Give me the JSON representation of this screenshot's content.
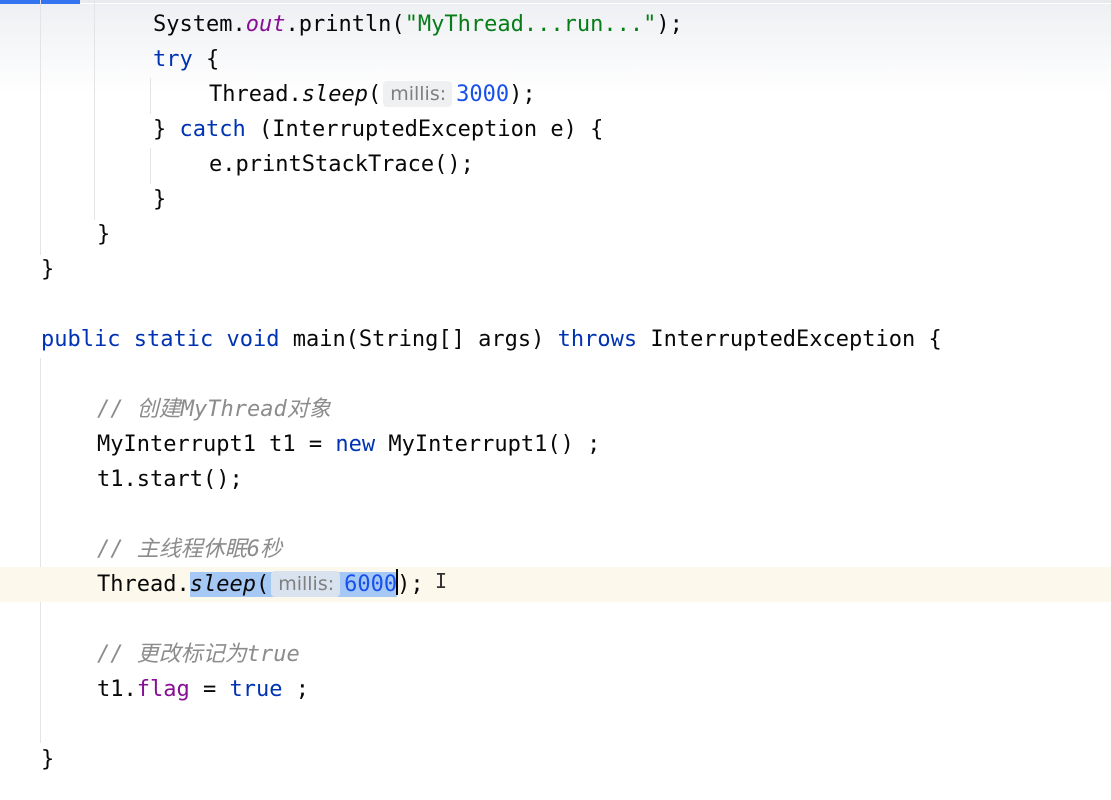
{
  "editor": {
    "language": "java",
    "current_line": "sleep_call",
    "lines": {
      "println": {
        "receiver": "System.",
        "field": "out",
        "method": ".println(",
        "string": "\"MyThread...run...\"",
        "tail": ");"
      },
      "try": {
        "keyword": "try",
        "tail": " {"
      },
      "inner_sleep": {
        "receiver": "Thread.",
        "method": "sleep",
        "paren": "(",
        "hint": "millis:",
        "arg": "3000",
        "tail": ");"
      },
      "catch": {
        "brace": "} ",
        "keyword": "catch",
        "tail": " (InterruptedException e) {"
      },
      "print_trace": {
        "text": "e.printStackTrace();"
      },
      "close_try": {
        "text": "}"
      },
      "close_run": {
        "text": "}"
      },
      "close_class": {
        "text": "}"
      },
      "main_signature": {
        "kw_public": "public",
        "kw_static": "static",
        "kw_void": "void",
        "name_params": "main(String[] args)",
        "kw_throws": "throws",
        "tail": "InterruptedException {"
      },
      "comment_create": {
        "text": "// 创建MyThread对象"
      },
      "new_object": {
        "head": "MyInterrupt1 t1 = ",
        "keyword": "new",
        "tail": " MyInterrupt1() ;"
      },
      "start_call": {
        "text": "t1.start();"
      },
      "comment_sleep": {
        "text": "// 主线程休眠6秒"
      },
      "sleep_call": {
        "receiver": "Thread.",
        "method": "sleep",
        "paren": "(",
        "hint": "millis:",
        "arg": "6000",
        "tail": ");"
      },
      "comment_flag": {
        "text": "// 更改标记为true"
      },
      "flag_assign": {
        "receiver": "t1.",
        "field": "flag",
        "op": " = ",
        "value": "true",
        "tail": " ;"
      },
      "close_main": {
        "text": "}"
      }
    }
  },
  "colors": {
    "keyword": "#0033b3",
    "field": "#871094",
    "string": "#067d17",
    "number": "#1750eb",
    "comment": "#8c8c8c",
    "selection": "#a6c8f5",
    "current_line_bg": "#fcf8ec",
    "tab_indicator": "#3574f0"
  },
  "icons": {
    "cursor": "text-cursor-icon"
  }
}
